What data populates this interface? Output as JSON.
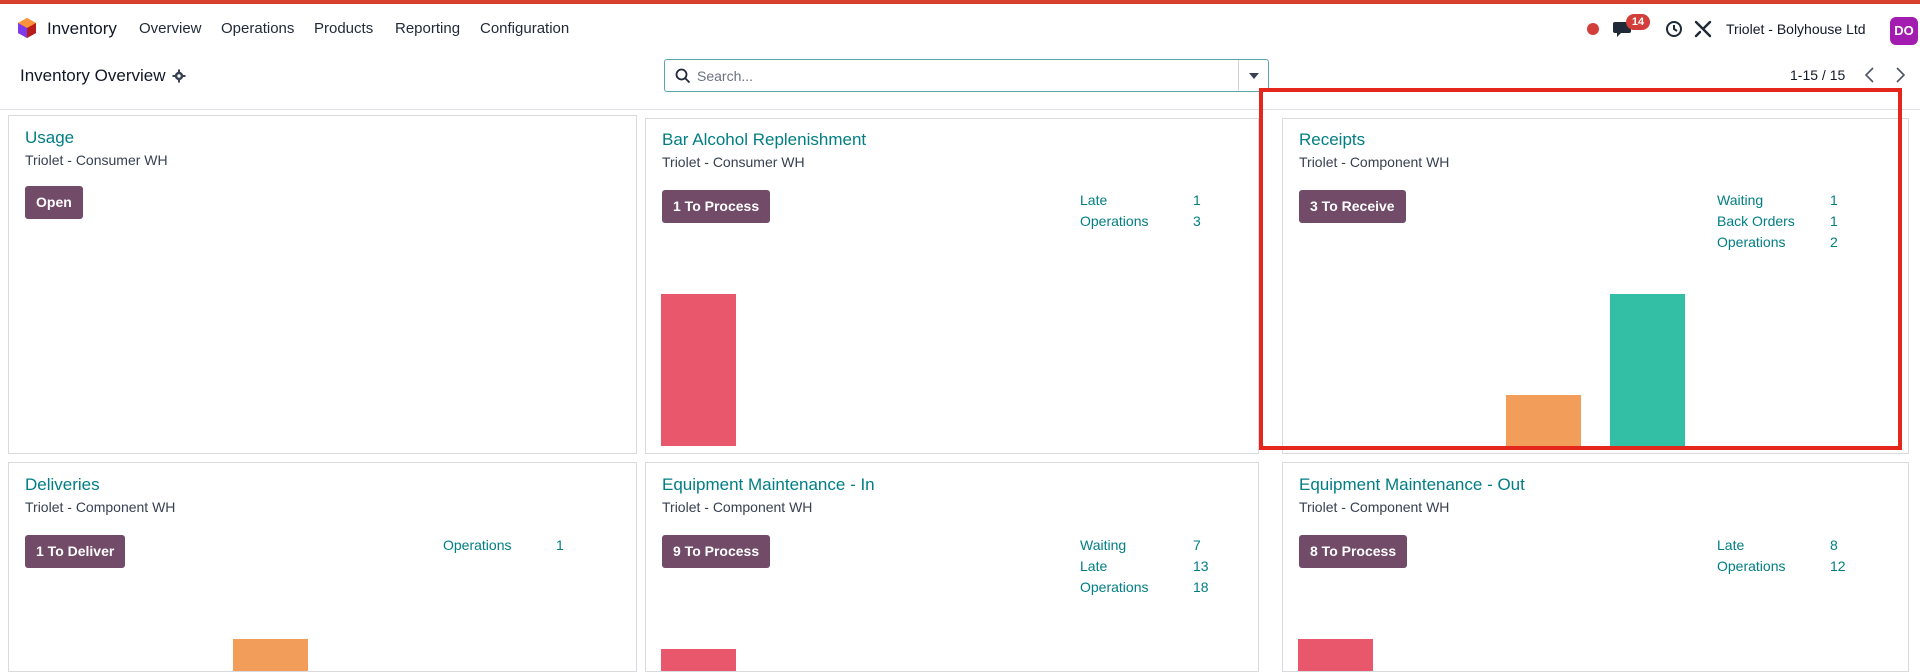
{
  "navbar": {
    "app_name": "Inventory",
    "menu": [
      "Overview",
      "Operations",
      "Products",
      "Reporting",
      "Configuration"
    ],
    "notification_count": "14",
    "company": "Triolet - Bolyhouse Ltd",
    "avatar_initials": "DO",
    "icons": [
      "app-logo-icon",
      "recording-dot-icon",
      "chat-icon",
      "clock-icon",
      "tools-icon"
    ]
  },
  "control_panel": {
    "title": "Inventory Overview",
    "search_placeholder": "Search...",
    "pager": "1-15 / 15"
  },
  "colors": {
    "accent": "#017e84",
    "button": "#714b67",
    "bar_late": "#e8576b",
    "bar_waiting": "#f29e5a",
    "bar_future": "#33bfa6",
    "highlight": "#e5261c"
  },
  "cards": [
    {
      "title": "Usage",
      "subtitle": "Triolet - Consumer WH",
      "button": "Open",
      "stats": []
    },
    {
      "title": "Bar Alcohol Replenishment",
      "subtitle": "Triolet - Consumer WH",
      "button": "1 To Process",
      "stats": [
        {
          "label": "Late",
          "value": "1"
        },
        {
          "label": "Operations",
          "value": "3"
        }
      ]
    },
    {
      "title": "Receipts",
      "subtitle": "Triolet - Component WH",
      "button": "3 To Receive",
      "stats": [
        {
          "label": "Waiting",
          "value": "1"
        },
        {
          "label": "Back Orders",
          "value": "1"
        },
        {
          "label": "Operations",
          "value": "2"
        }
      ]
    },
    {
      "title": "Deliveries",
      "subtitle": "Triolet - Component WH",
      "button": "1 To Deliver",
      "stats": [
        {
          "label": "Operations",
          "value": "1"
        }
      ]
    },
    {
      "title": "Equipment Maintenance - In",
      "subtitle": "Triolet - Component WH",
      "button": "9 To Process",
      "stats": [
        {
          "label": "Waiting",
          "value": "7"
        },
        {
          "label": "Late",
          "value": "13"
        },
        {
          "label": "Operations",
          "value": "18"
        }
      ]
    },
    {
      "title": "Equipment Maintenance - Out",
      "subtitle": "Triolet - Component WH",
      "button": "8 To Process",
      "stats": [
        {
          "label": "Late",
          "value": "8"
        },
        {
          "label": "Operations",
          "value": "12"
        }
      ]
    }
  ]
}
